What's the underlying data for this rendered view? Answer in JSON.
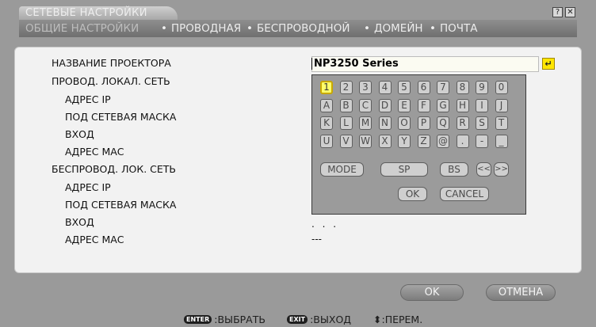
{
  "window": {
    "title": "СЕТЕВЫЕ НАСТРОЙКИ",
    "help_icon": "?",
    "close_icon": "✕"
  },
  "tabs": [
    {
      "label": "ОБЩИЕ НАСТРОЙКИ"
    },
    {
      "label": "ПРОВОДНАЯ"
    },
    {
      "label": "БЕСПРОВОДНОЙ"
    },
    {
      "label": "ДОМЕЙН"
    },
    {
      "label": "ПОЧТА"
    }
  ],
  "tab_separator": "•",
  "settings": {
    "projector_name_label": "НАЗВАНИЕ ПРОЕКТОРА",
    "projector_name_value": "NP3250 Series",
    "wired_lan_label": "ПРОВОД. ЛОКАЛ. СЕТЬ",
    "wired_ip_label": "АДРЕС IP",
    "wired_subnet_label": "ПОД СЕТЕВАЯ МАСКА",
    "wired_gateway_label": "ВХОД",
    "wired_mac_label": "АДРЕС МАС",
    "wireless_lan_label": "БЕСПРОВОД. ЛОК. СЕТЬ",
    "wireless_ip_label": "АДРЕС IP",
    "wireless_subnet_label": "ПОД СЕТЕВАЯ МАСКА",
    "wireless_gateway_label": "ВХОД",
    "wireless_mac_label": "АДРЕС МАС",
    "wireless_gateway_value": ". . .",
    "wireless_mac_value": "---"
  },
  "keyboard": {
    "rows": [
      [
        "1",
        "2",
        "3",
        "4",
        "5",
        "6",
        "7",
        "8",
        "9",
        "0"
      ],
      [
        "A",
        "B",
        "C",
        "D",
        "E",
        "F",
        "G",
        "H",
        "I",
        "J"
      ],
      [
        "K",
        "L",
        "M",
        "N",
        "O",
        "P",
        "Q",
        "R",
        "S",
        "T"
      ],
      [
        "U",
        "V",
        "W",
        "X",
        "Y",
        "Z",
        "@",
        ".",
        "-",
        "_"
      ]
    ],
    "selected_key": "1",
    "mode_label": "MODE",
    "sp_label": "SP",
    "bs_label": "BS",
    "left_label": "<<",
    "right_label": ">>",
    "ok_label": "OK",
    "cancel_label": "CANCEL"
  },
  "buttons": {
    "ok_label": "OK",
    "cancel_label": "ОТМЕНА"
  },
  "footer": {
    "enter_badge": "ENTER",
    "enter_text": ":ВЫБРАТЬ",
    "exit_badge": "EXIT",
    "exit_text": ":ВЫХОД",
    "nav_symbol": "⬍",
    "nav_text": ":ПЕРЕМ."
  },
  "colors": {
    "selected_key": "#ffff6a",
    "enter_button": "#ffe600",
    "background": "#9a9a9a"
  }
}
